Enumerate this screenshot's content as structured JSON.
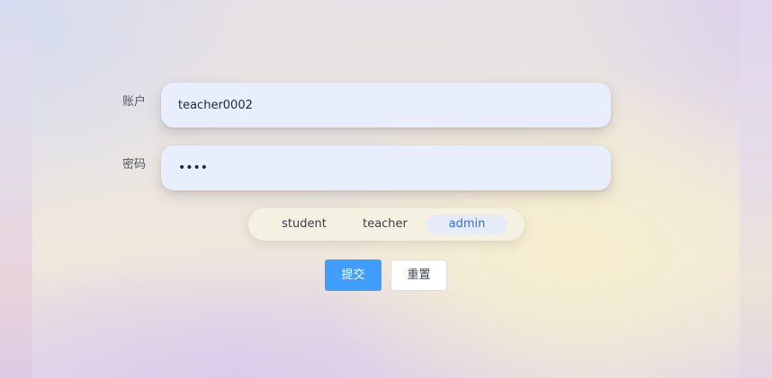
{
  "form": {
    "account": {
      "label": "账户",
      "value": "teacher0002"
    },
    "password": {
      "label": "密码",
      "value": "••••"
    }
  },
  "role_switch": {
    "options": [
      "student",
      "teacher",
      "admin"
    ],
    "selected": "admin"
  },
  "actions": {
    "submit_label": "提交",
    "reset_label": "重置"
  },
  "colors": {
    "primary": "#409eff",
    "selected_role_text": "#3a6fd0",
    "input_bg": "#e8eefc"
  }
}
